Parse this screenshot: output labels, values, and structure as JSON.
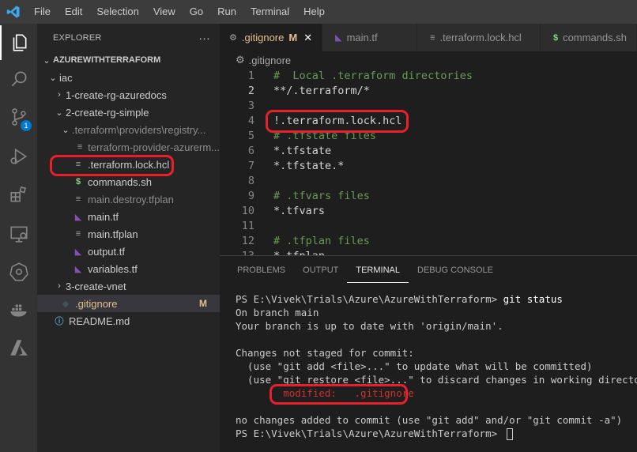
{
  "menu": [
    "File",
    "Edit",
    "Selection",
    "View",
    "Go",
    "Run",
    "Terminal",
    "Help"
  ],
  "activity_bar": {
    "source_control_badge": "1"
  },
  "explorer": {
    "title": "EXPLORER",
    "more_label": "···",
    "rows": [
      {
        "label": "AZUREWITHTERRAFORM",
        "chevron": "⌄",
        "icon": "",
        "indent": 0
      },
      {
        "label": "iac",
        "chevron": "⌄",
        "icon": "",
        "indent": 1
      },
      {
        "label": "1-create-rg-azuredocs",
        "chevron": "›",
        "icon": "",
        "indent": 2
      },
      {
        "label": "2-create-rg-simple",
        "chevron": "⌄",
        "icon": "",
        "indent": 2
      },
      {
        "label": ".terraform\\providers\\registry...",
        "chevron": "⌄",
        "icon": "",
        "indent": 3
      },
      {
        "label": "terraform-provider-azurerm...",
        "chevron": "",
        "icon": "file",
        "indent": 4
      },
      {
        "label": ".terraform.lock.hcl",
        "chevron": "",
        "icon": "file",
        "indent": 3
      },
      {
        "label": "commands.sh",
        "chevron": "",
        "icon": "shell",
        "indent": 3
      },
      {
        "label": "main.destroy.tfplan",
        "chevron": "",
        "icon": "file",
        "indent": 3
      },
      {
        "label": "main.tf",
        "chevron": "",
        "icon": "terraform",
        "indent": 3
      },
      {
        "label": "main.tfplan",
        "chevron": "",
        "icon": "file",
        "indent": 3
      },
      {
        "label": "output.tf",
        "chevron": "",
        "icon": "terraform",
        "indent": 3
      },
      {
        "label": "variables.tf",
        "chevron": "",
        "icon": "terraform",
        "indent": 3
      },
      {
        "label": "3-create-vnet",
        "chevron": "›",
        "icon": "",
        "indent": 2
      },
      {
        "label": ".gitignore",
        "chevron": "",
        "icon": "gitignore",
        "indent": 1,
        "status": "M"
      },
      {
        "label": "README.md",
        "chevron": "",
        "icon": "info",
        "indent": 0
      }
    ]
  },
  "tabs": [
    {
      "label": ".gitignore",
      "status": "M",
      "close": "✕",
      "icon": "gear"
    },
    {
      "label": "main.tf",
      "icon": "terraform"
    },
    {
      "label": ".terraform.lock.hcl",
      "icon": "lines"
    },
    {
      "label": "commands.sh",
      "icon": "shell"
    }
  ],
  "breadcrumb": ".gitignore",
  "code": [
    {
      "n": "1",
      "text": "#  Local .terraform directories",
      "kind": "comment"
    },
    {
      "n": "2",
      "text": "**/.terraform/*",
      "kind": "text"
    },
    {
      "n": "3",
      "text": "",
      "kind": "text"
    },
    {
      "n": "4",
      "text": "!.terraform.lock.hcl",
      "kind": "text"
    },
    {
      "n": "5",
      "text": "# .tfstate files",
      "kind": "comment"
    },
    {
      "n": "6",
      "text": "*.tfstate",
      "kind": "text"
    },
    {
      "n": "7",
      "text": "*.tfstate.*",
      "kind": "text"
    },
    {
      "n": "8",
      "text": "",
      "kind": "text"
    },
    {
      "n": "9",
      "text": "# .tfvars files",
      "kind": "comment"
    },
    {
      "n": "10",
      "text": "*.tfvars",
      "kind": "text"
    },
    {
      "n": "11",
      "text": "",
      "kind": "text"
    },
    {
      "n": "12",
      "text": "# .tfplan files",
      "kind": "comment"
    },
    {
      "n": "13",
      "text": "*.tfplan",
      "kind": "text"
    }
  ],
  "panel": {
    "tabs": [
      "PROBLEMS",
      "OUTPUT",
      "TERMINAL",
      "DEBUG CONSOLE"
    ],
    "active_tab": "TERMINAL"
  },
  "terminal": [
    {
      "text": "PS E:\\Vivek\\Trials\\Azure\\AzureWithTerraform> ",
      "cmd": "git status"
    },
    {
      "text": "On branch main"
    },
    {
      "text": "Your branch is up to date with 'origin/main'."
    },
    {
      "text": ""
    },
    {
      "text": "Changes not staged for commit:"
    },
    {
      "text": "  (use \"git add <file>...\" to update what will be committed)"
    },
    {
      "text": "  (use \"git restore <file>...\" to discard changes in working directory)"
    },
    {
      "text": "        modified:   .gitignore",
      "kind": "modified"
    },
    {
      "text": ""
    },
    {
      "text": "no changes added to commit (use \"git add\" and/or \"git commit -a\")"
    },
    {
      "text": "PS E:\\Vivek\\Trials\\Azure\\AzureWithTerraform> ",
      "cursor": true
    }
  ],
  "colors": {
    "highlight": "#e8202a",
    "accent": "#007acc",
    "modified": "#e2c08d",
    "comment": "#6a9955",
    "terraform": "#844fba",
    "shell": "#89d185"
  }
}
